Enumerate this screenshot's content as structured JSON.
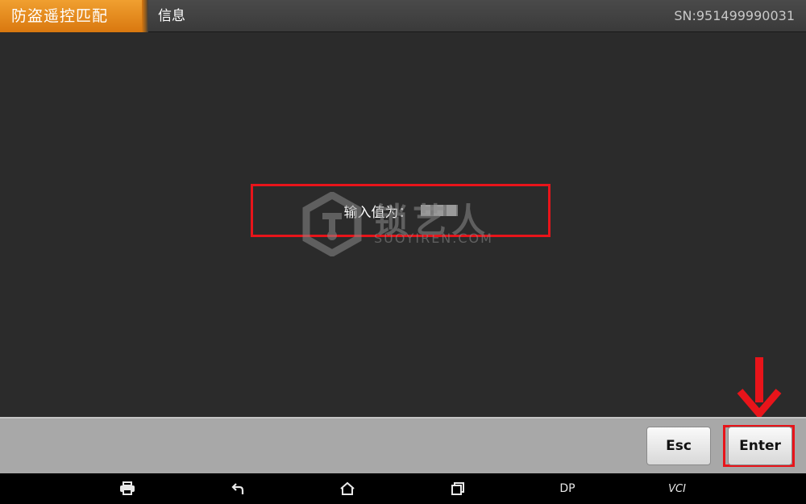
{
  "header": {
    "active_tab": "防盗遥控匹配",
    "subtitle": "信息",
    "serial": "SN:951499990031"
  },
  "content": {
    "message_label": "输入值为："
  },
  "watermark": {
    "cn_text": "锁艺人",
    "en_text": "SUOYIREN.COM"
  },
  "buttons": {
    "esc_label": "Esc",
    "enter_label": "Enter"
  },
  "nav_bar": {
    "dp_label": "DP",
    "vci_label": "VCI"
  },
  "colors": {
    "accent_orange": "#e38a1f",
    "highlight_red": "#e8141a",
    "background": "#2b2b2b",
    "button_bar": "#a8a8a8"
  },
  "icons": [
    "print-icon",
    "back-icon",
    "home-icon",
    "recent-apps-icon"
  ]
}
